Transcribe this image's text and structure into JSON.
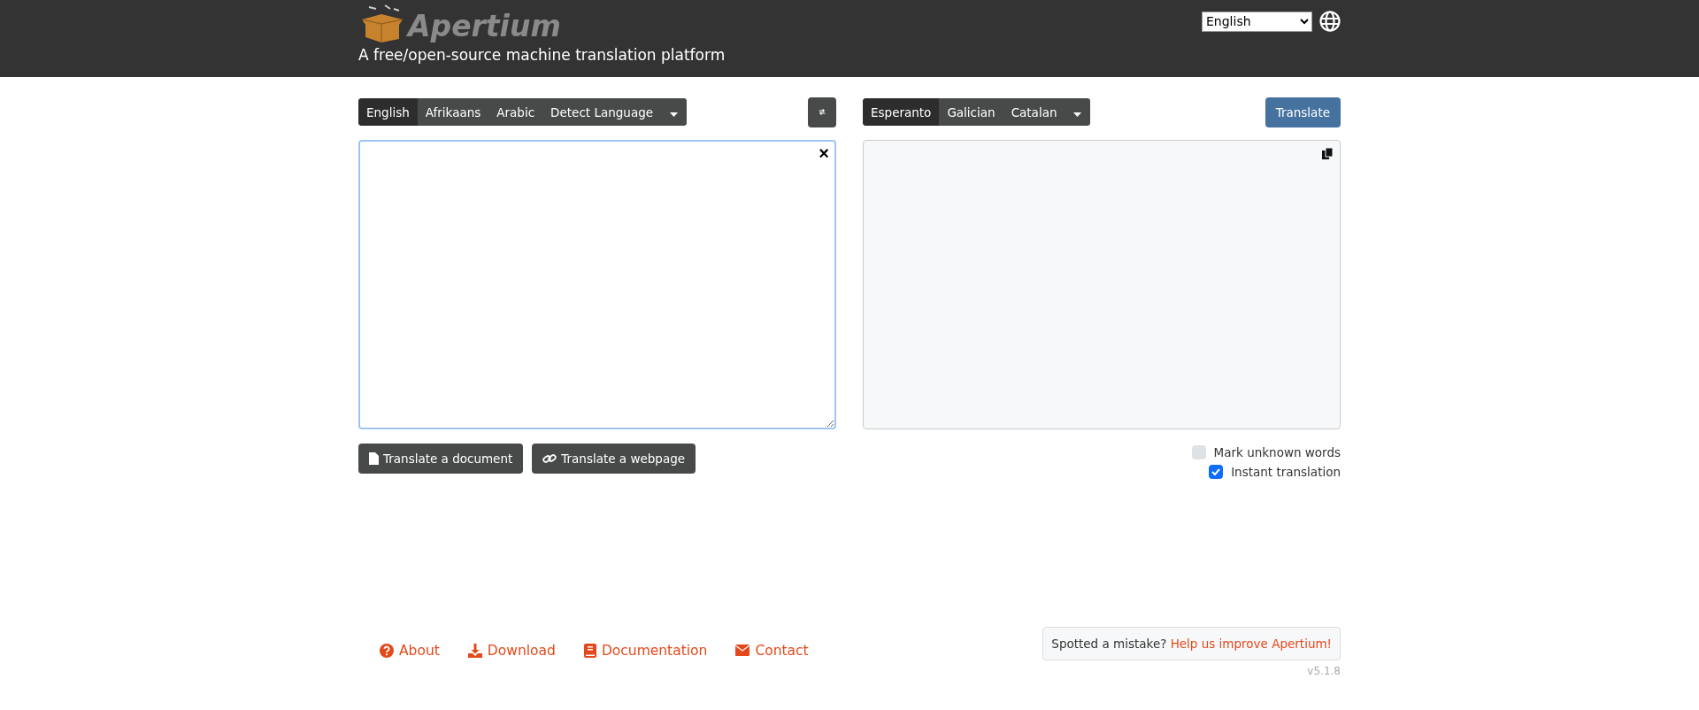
{
  "header": {
    "logo_text": "Apertium",
    "tagline": "A free/open-source machine translation platform",
    "locale_select": {
      "value": "English"
    }
  },
  "source_languages": [
    {
      "label": "English",
      "selected": true
    },
    {
      "label": "Afrikaans",
      "selected": false
    },
    {
      "label": "Arabic",
      "selected": false
    },
    {
      "label": "Detect Language",
      "selected": false
    }
  ],
  "target_languages": [
    {
      "label": "Esperanto",
      "selected": true
    },
    {
      "label": "Galician",
      "selected": false
    },
    {
      "label": "Catalan",
      "selected": false
    }
  ],
  "translate_button": "Translate",
  "source_box": {
    "clear_button": "×"
  },
  "source_actions": [
    {
      "kind": "document",
      "label": "Translate a document"
    },
    {
      "kind": "webpage",
      "label": "Translate a webpage"
    }
  ],
  "options": [
    {
      "label": "Mark unknown words",
      "checked": false
    },
    {
      "label": "Instant translation",
      "checked": true
    }
  ],
  "footer": {
    "links": [
      {
        "kind": "about",
        "label": "About"
      },
      {
        "kind": "download",
        "label": "Download"
      },
      {
        "kind": "documentation",
        "label": "Documentation"
      },
      {
        "kind": "contact",
        "label": "Contact"
      }
    ],
    "feedback": {
      "text": "Spotted a mistake?",
      "link": "Help us improve Apertium!"
    },
    "version": "v5.1.8"
  }
}
